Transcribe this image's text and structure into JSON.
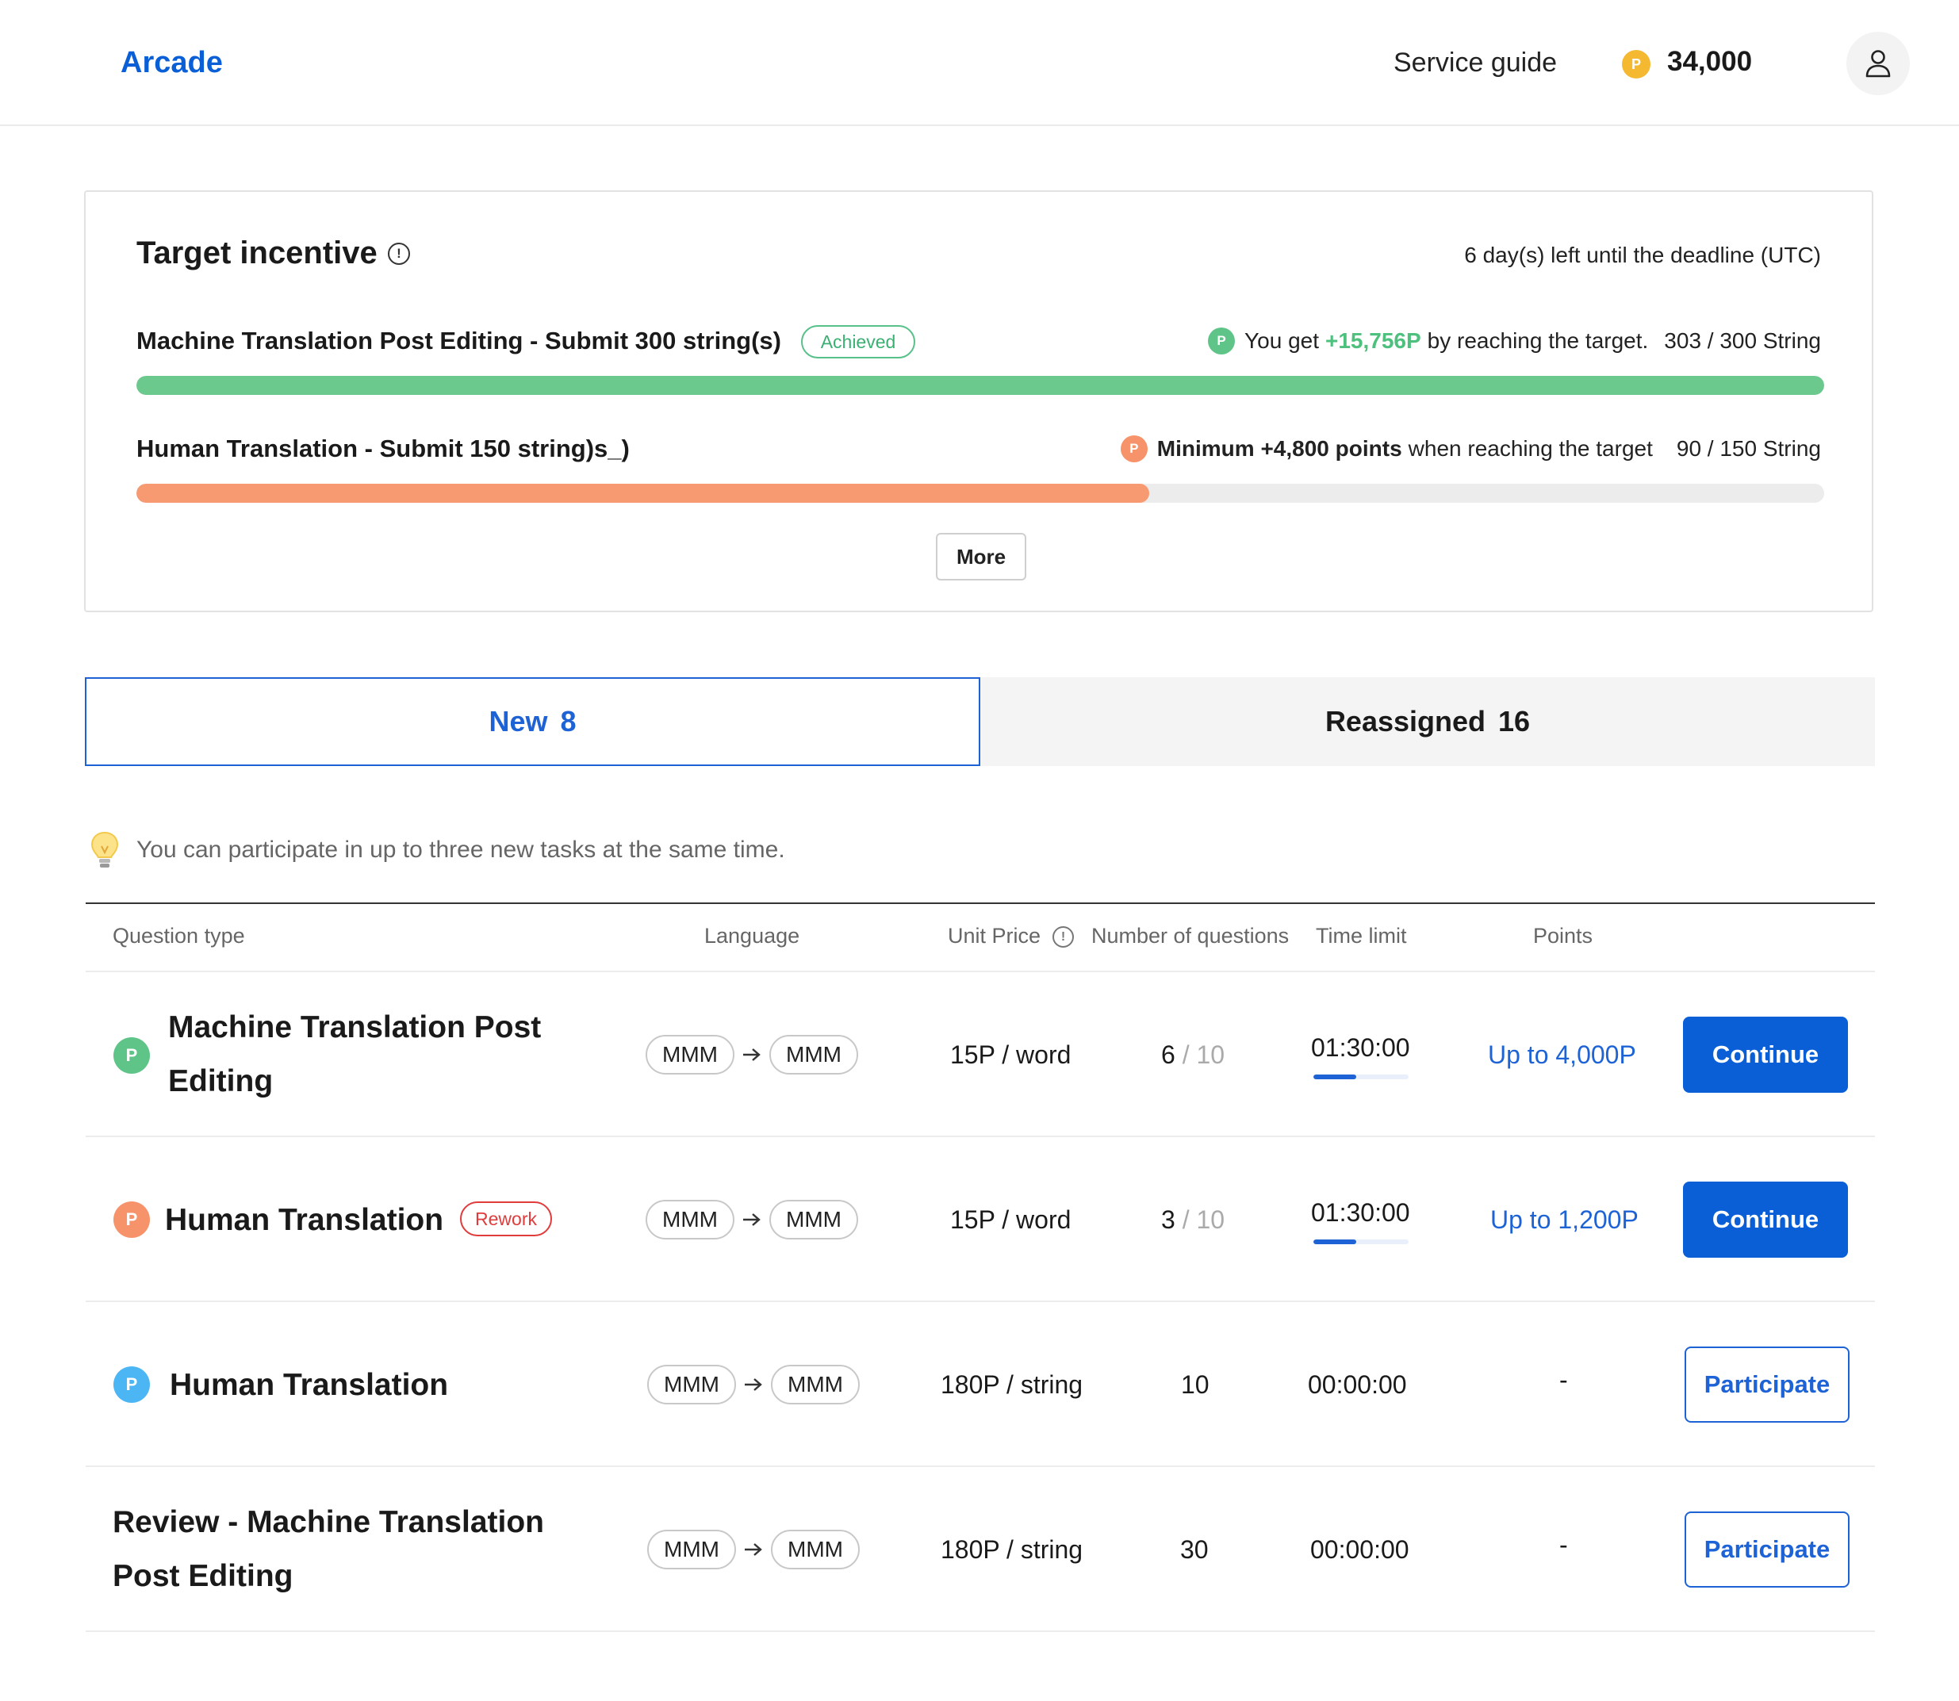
{
  "header": {
    "brand": "Arcade",
    "service_guide": "Service guide",
    "points_balance": "34,000",
    "coin_letter": "P",
    "avatar_icon": "user-icon"
  },
  "incentive": {
    "title": "Target incentive",
    "info_glyph": "!",
    "deadline": "6 day(s) left until the deadline (UTC)",
    "goals": [
      {
        "title": "Machine Translation Post Editing - Submit 300 string(s)",
        "badge": "Achieved",
        "coin_letter": "P",
        "reward_prefix": "You get",
        "reward_amount": "+15,756P",
        "reward_suffix": "by reaching the target.",
        "progress_text": "303 / 300 String",
        "progress": 1.0,
        "color": "#6cc98e"
      },
      {
        "title": "Human Translation - Submit 150 string)s_)",
        "coin_letter": "P",
        "reward_bold": "Minimum +4,800 points",
        "reward_suffix": "when reaching the target",
        "progress_text": "90 / 150 String",
        "progress": 0.6,
        "color": "#f79a72"
      }
    ],
    "more_label": "More"
  },
  "tabs": [
    {
      "label": "New",
      "count": "8",
      "active": true
    },
    {
      "label": "Reassigned",
      "count": "16",
      "active": false
    }
  ],
  "notice": "You can participate in up to three new tasks at the same time.",
  "table": {
    "headers": {
      "question_type": "Question type",
      "language": "Language",
      "unit_price": "Unit Price",
      "num_questions": "Number of questions",
      "time_limit": "Time limit",
      "points": "Points"
    },
    "rows": [
      {
        "title_line1": "Machine Translation Post",
        "title_line2": "Editing",
        "coin_letter": "P",
        "coin_color": "#5fc487",
        "source_lang": "MMM",
        "target_lang": "MMM",
        "unit_price": "15P / word",
        "done": "6",
        "total": "/ 10",
        "time_limit": "01:30:00",
        "time_progress": 0.45,
        "points": "Up to 4,000P",
        "action": "Continue"
      },
      {
        "title": "Human Translation",
        "badge": "Rework",
        "coin_letter": "P",
        "coin_color": "#f7936b",
        "source_lang": "MMM",
        "target_lang": "MMM",
        "unit_price": "15P / word",
        "done": "3",
        "total": "/ 10",
        "time_limit": "01:30:00",
        "time_progress": 0.45,
        "points": "Up to 1,200P",
        "action": "Continue"
      },
      {
        "title": "Human Translation",
        "coin_letter": "P",
        "coin_color": "#4cb6f5",
        "source_lang": "MMM",
        "target_lang": "MMM",
        "unit_price": "180P / string",
        "questions": "10",
        "time_limit": "00:00:00",
        "points": "-",
        "action": "Participate"
      },
      {
        "title_line1": "Review - Machine Translation",
        "title_line2": "Post Editing",
        "source_lang": "MMM",
        "target_lang": "MMM",
        "unit_price": "180P / string",
        "questions": "30",
        "time_limit": "00:00:00",
        "points": "-",
        "action": "Participate"
      }
    ]
  }
}
